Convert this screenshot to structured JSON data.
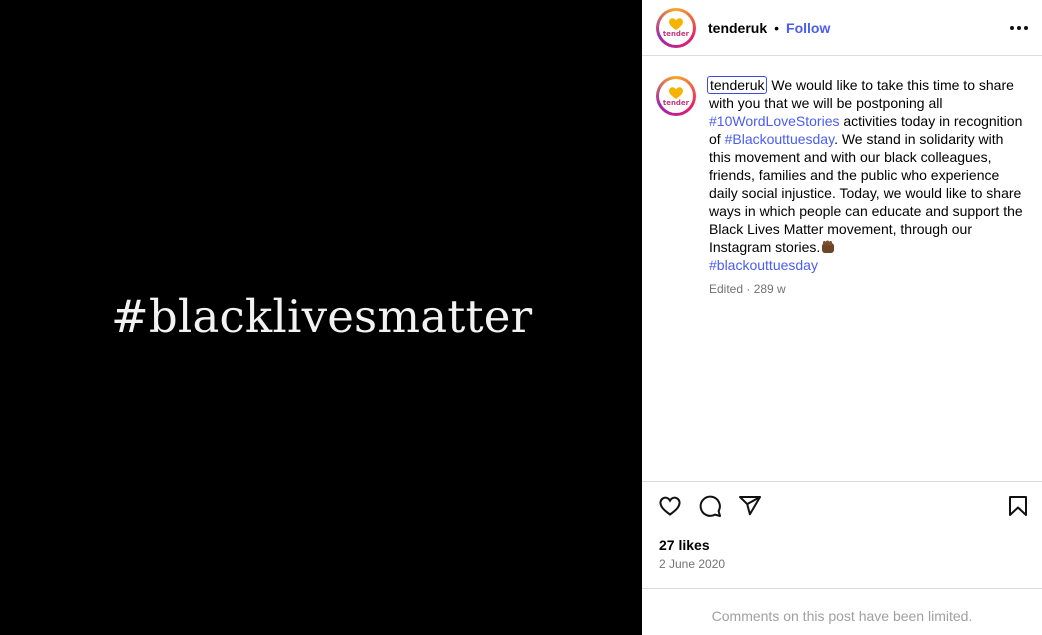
{
  "media": {
    "text": "#blacklivesmatter"
  },
  "header": {
    "avatar_word": "tender",
    "username": "tenderuk",
    "separator": "•",
    "follow_label": "Follow"
  },
  "caption": {
    "avatar_word": "tender",
    "username": "tenderuk",
    "part1": " We would like to take this time to share with you that we will be postponing all ",
    "tag1": "#10WordLoveStories",
    "part2": " activities today in recognition of ",
    "tag2": "#Blackouttuesday",
    "part3": ". We stand in solidarity with this movement and with our black colleagues, friends, families and the public who experience daily social injustice. Today, we would like to share ways in which people can educate and support the Black Lives Matter movement, through our Instagram stories.",
    "tag3": "#blackouttuesday",
    "meta": "Edited · 289 w"
  },
  "actions": {
    "likes": "27 likes",
    "date": "2 June 2020"
  },
  "comments": {
    "limited_notice": "Comments on this post have been limited."
  },
  "colors": {
    "link": "#4a5df0",
    "muted": "#737373",
    "border": "#dbdbdb"
  },
  "icons": [
    "heart-icon",
    "comment-icon",
    "share-icon",
    "bookmark-icon",
    "more-icon",
    "fist-emoji"
  ]
}
